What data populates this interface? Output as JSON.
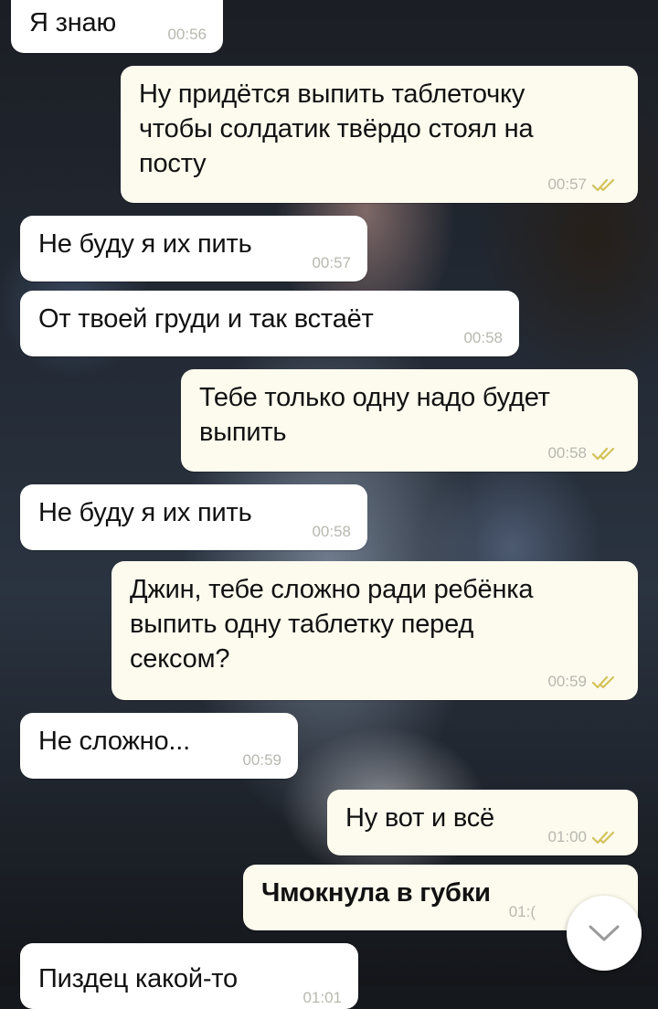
{
  "messages": [
    {
      "text": "Я знаю",
      "time": "00:56"
    },
    {
      "text": "Ну придётся выпить таблеточку\nчтобы солдатик твёрдо стоял на\nпосту",
      "time": "00:57"
    },
    {
      "text": "Не буду я их пить",
      "time": "00:57"
    },
    {
      "text": "От твоей груди и так встаёт",
      "time": "00:58"
    },
    {
      "text": "Тебе только одну надо будет\nвыпить",
      "time": "00:58"
    },
    {
      "text": "Не буду я их пить",
      "time": "00:58"
    },
    {
      "text": "Джин, тебе сложно ради ребёнка\nвыпить одну таблетку перед\nсексом?",
      "time": "00:59"
    },
    {
      "text": "Не сложно...",
      "time": "00:59"
    },
    {
      "text": "Ну вот и всё",
      "time": "01:00"
    },
    {
      "text": "Чмокнула в губки",
      "time": "01:("
    },
    {
      "text": "Пиздец какой-то",
      "time": "01:01"
    }
  ],
  "icons": {
    "read_receipt": "double-check-icon",
    "scroll_down": "chevron-down-icon"
  },
  "colors": {
    "incoming_bubble": "#ffffff",
    "outgoing_bubble": "#fdfbee",
    "read_check": "#d3c25a",
    "timestamp": "#b8b8b0"
  }
}
